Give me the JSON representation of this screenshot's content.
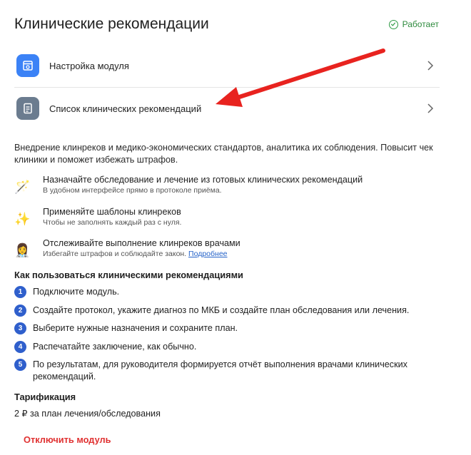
{
  "header": {
    "title": "Клинические рекомендации",
    "status": "Работает"
  },
  "menu": [
    {
      "label": "Настройка модуля",
      "icon": "module-settings-icon"
    },
    {
      "label": "Список клинических рекомендаций",
      "icon": "document-list-icon"
    }
  ],
  "description": "Внедрение клинреков и медико-экономических стандартов, аналитика их соблюдения. Повысит чек клиники и поможет избежать штрафов.",
  "features": [
    {
      "emoji": "🪄",
      "title": "Назначайте обследование и лечение из готовых клинических рекомендаций",
      "subtitle": "В удобном интерфейсе прямо в протоколе приёма."
    },
    {
      "emoji": "✨",
      "title": "Применяйте шаблоны клинреков",
      "subtitle": "Чтобы не заполнять каждый раз с нуля."
    },
    {
      "emoji": "👩‍⚕️",
      "title": "Отслеживайте выполнение клинреков врачами",
      "subtitle": "Избегайте штрафов и соблюдайте закон.",
      "link": "Подробнее"
    }
  ],
  "howto": {
    "title": "Как пользоваться клиническими рекомендациями",
    "steps": [
      {
        "num": "1",
        "text": "Подключите модуль."
      },
      {
        "num": "2",
        "text": "Создайте протокол, укажите диагноз по МКБ и создайте план обследования или лечения."
      },
      {
        "num": "3",
        "text": "Выберите нужные назначения и сохраните план."
      },
      {
        "num": "4",
        "text": "Распечатайте заключение, как обычно."
      },
      {
        "num": "5",
        "text": "По результатам, для руководителя формируется отчёт выполнения врачами клинических рекомендаций."
      }
    ]
  },
  "tariff": {
    "title": "Тарификация",
    "text": "2 ₽ за план лечения/обследования"
  },
  "disable_label": "Отключить модуль",
  "colors": {
    "accent": "#3b82f6",
    "status_green": "#2e8b3e",
    "step_blue": "#2f5fcc",
    "danger": "#e03131",
    "annotation_arrow": "#e8231f"
  }
}
